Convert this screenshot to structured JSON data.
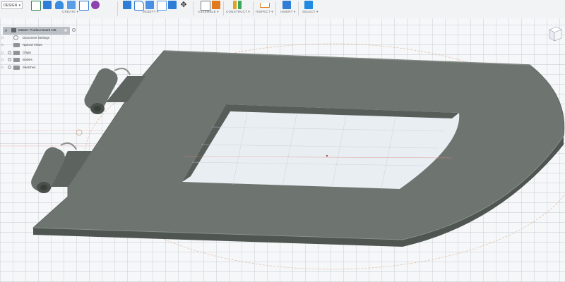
{
  "workspace": {
    "label": "DESIGN"
  },
  "toolbar": {
    "groups": [
      {
        "label": "CREATE ▾",
        "icons": [
          "sketch-icon",
          "extrude-icon",
          "revolve-icon",
          "sweep-icon",
          "box-icon",
          "form-icon"
        ]
      },
      {
        "label": "MODIFY ▾",
        "icons": [
          "press-pull-icon",
          "fillet-icon",
          "chamfer-icon",
          "shell-icon",
          "scale-icon",
          "move-icon"
        ]
      },
      {
        "label": "ASSEMBLE ▾",
        "icons": [
          "new-component-icon",
          "joint-icon"
        ]
      },
      {
        "label": "CONSTRUCT ▾",
        "icons": [
          "offset-plane-icon",
          "axis-icon"
        ]
      },
      {
        "label": "INSPECT ▾",
        "icons": [
          "measure-icon"
        ]
      },
      {
        "label": "INSERT ▾",
        "icons": [
          "insert-image-icon"
        ]
      },
      {
        "label": "SELECT ▾",
        "icons": [
          "select-icon"
        ]
      }
    ],
    "colors": {
      "accent": "#2e7dd7",
      "orange": "#e07a1f",
      "purple": "#8e44ad"
    }
  },
  "browser": {
    "root": "Master: Product Board v45",
    "items": [
      {
        "label": "Document Settings",
        "icon": "gear-icon"
      },
      {
        "label": "Named Views",
        "icon": "folder-icon"
      },
      {
        "label": "Origin",
        "icon": "folder-icon"
      },
      {
        "label": "Bodies",
        "icon": "folder-icon"
      },
      {
        "label": "Sketches",
        "icon": "folder-icon"
      }
    ]
  },
  "scene": {
    "body_color": "#6e746f",
    "body_dark": "#4f5550",
    "body_light": "#7d847e"
  },
  "viewcube": {
    "icon": "viewcube-icon"
  }
}
